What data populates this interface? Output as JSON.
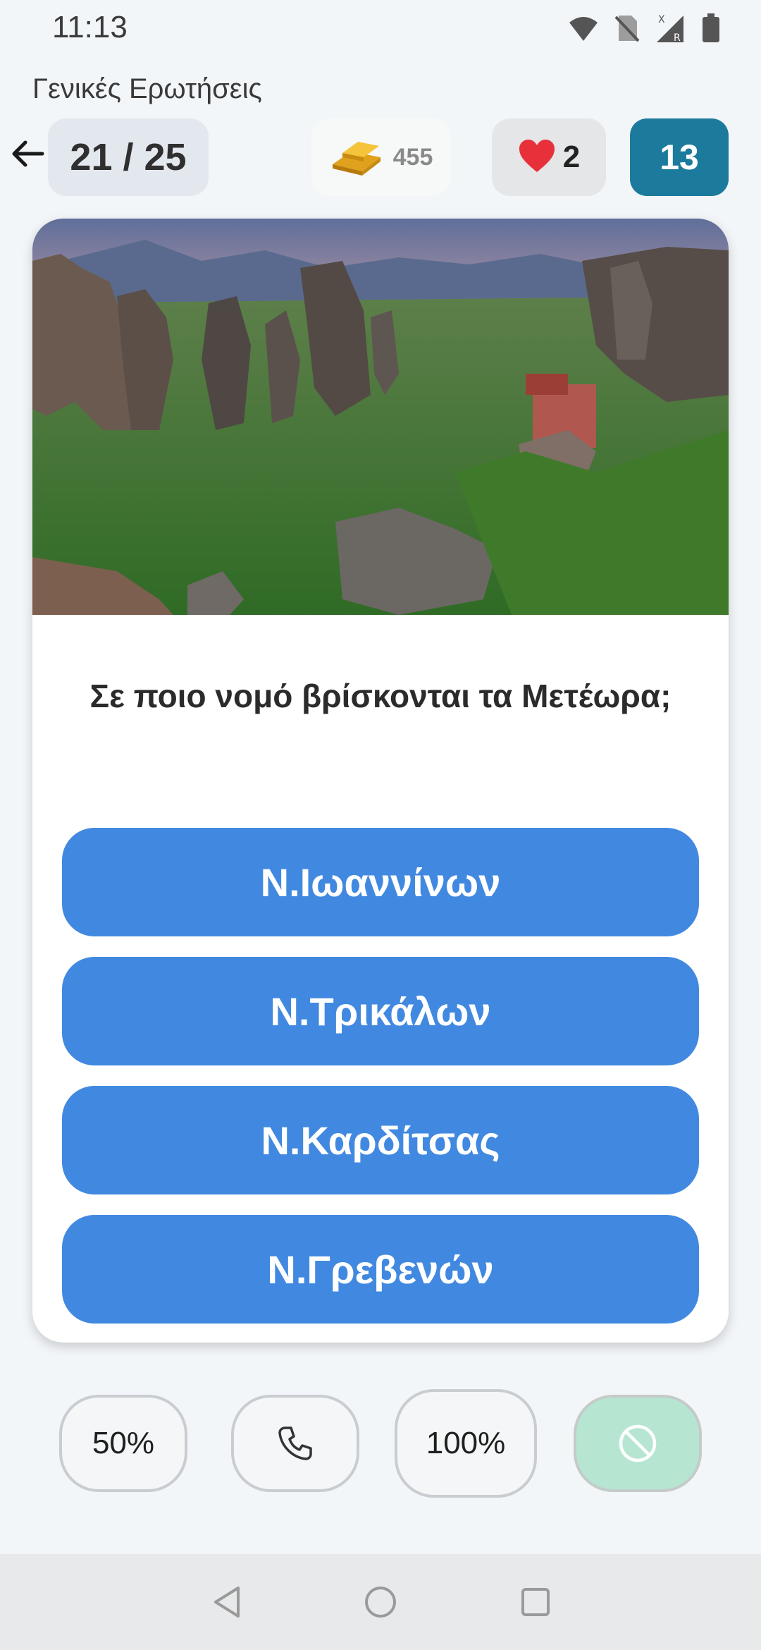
{
  "status_bar": {
    "time": "11:13",
    "icons": [
      "wifi-icon",
      "no-sim-icon",
      "signal-roaming-icon",
      "battery-icon"
    ],
    "signal_badge": "R"
  },
  "header": {
    "category": "Γενικές Ερωτήσεις",
    "progress": "21 / 25",
    "progress_current": 21,
    "progress_total": 25,
    "coins": "455",
    "lives": "2",
    "timer": "13"
  },
  "question": {
    "image": "meteora-landscape",
    "text": "Σε ποιο νομό βρίσκονται τα Μετέωρα;",
    "answers": [
      {
        "label": "Ν.Ιωαννίνων"
      },
      {
        "label": "Ν.Τρικάλων"
      },
      {
        "label": "Ν.Καρδίτσας"
      },
      {
        "label": "Ν.Γρεβενών"
      }
    ]
  },
  "lifelines": {
    "fifty": "50%",
    "phone_icon": "phone-icon",
    "hundred": "100%",
    "skip_icon": "block-icon"
  },
  "colors": {
    "answer_button": "#4189e0",
    "timer_bg": "#1c7b9c",
    "skip_bg": "#b6e6d2",
    "counter_bg": "#e3e8ee"
  },
  "navigation": {
    "icons": [
      "back-triangle-icon",
      "home-circle-icon",
      "recents-square-icon"
    ]
  }
}
